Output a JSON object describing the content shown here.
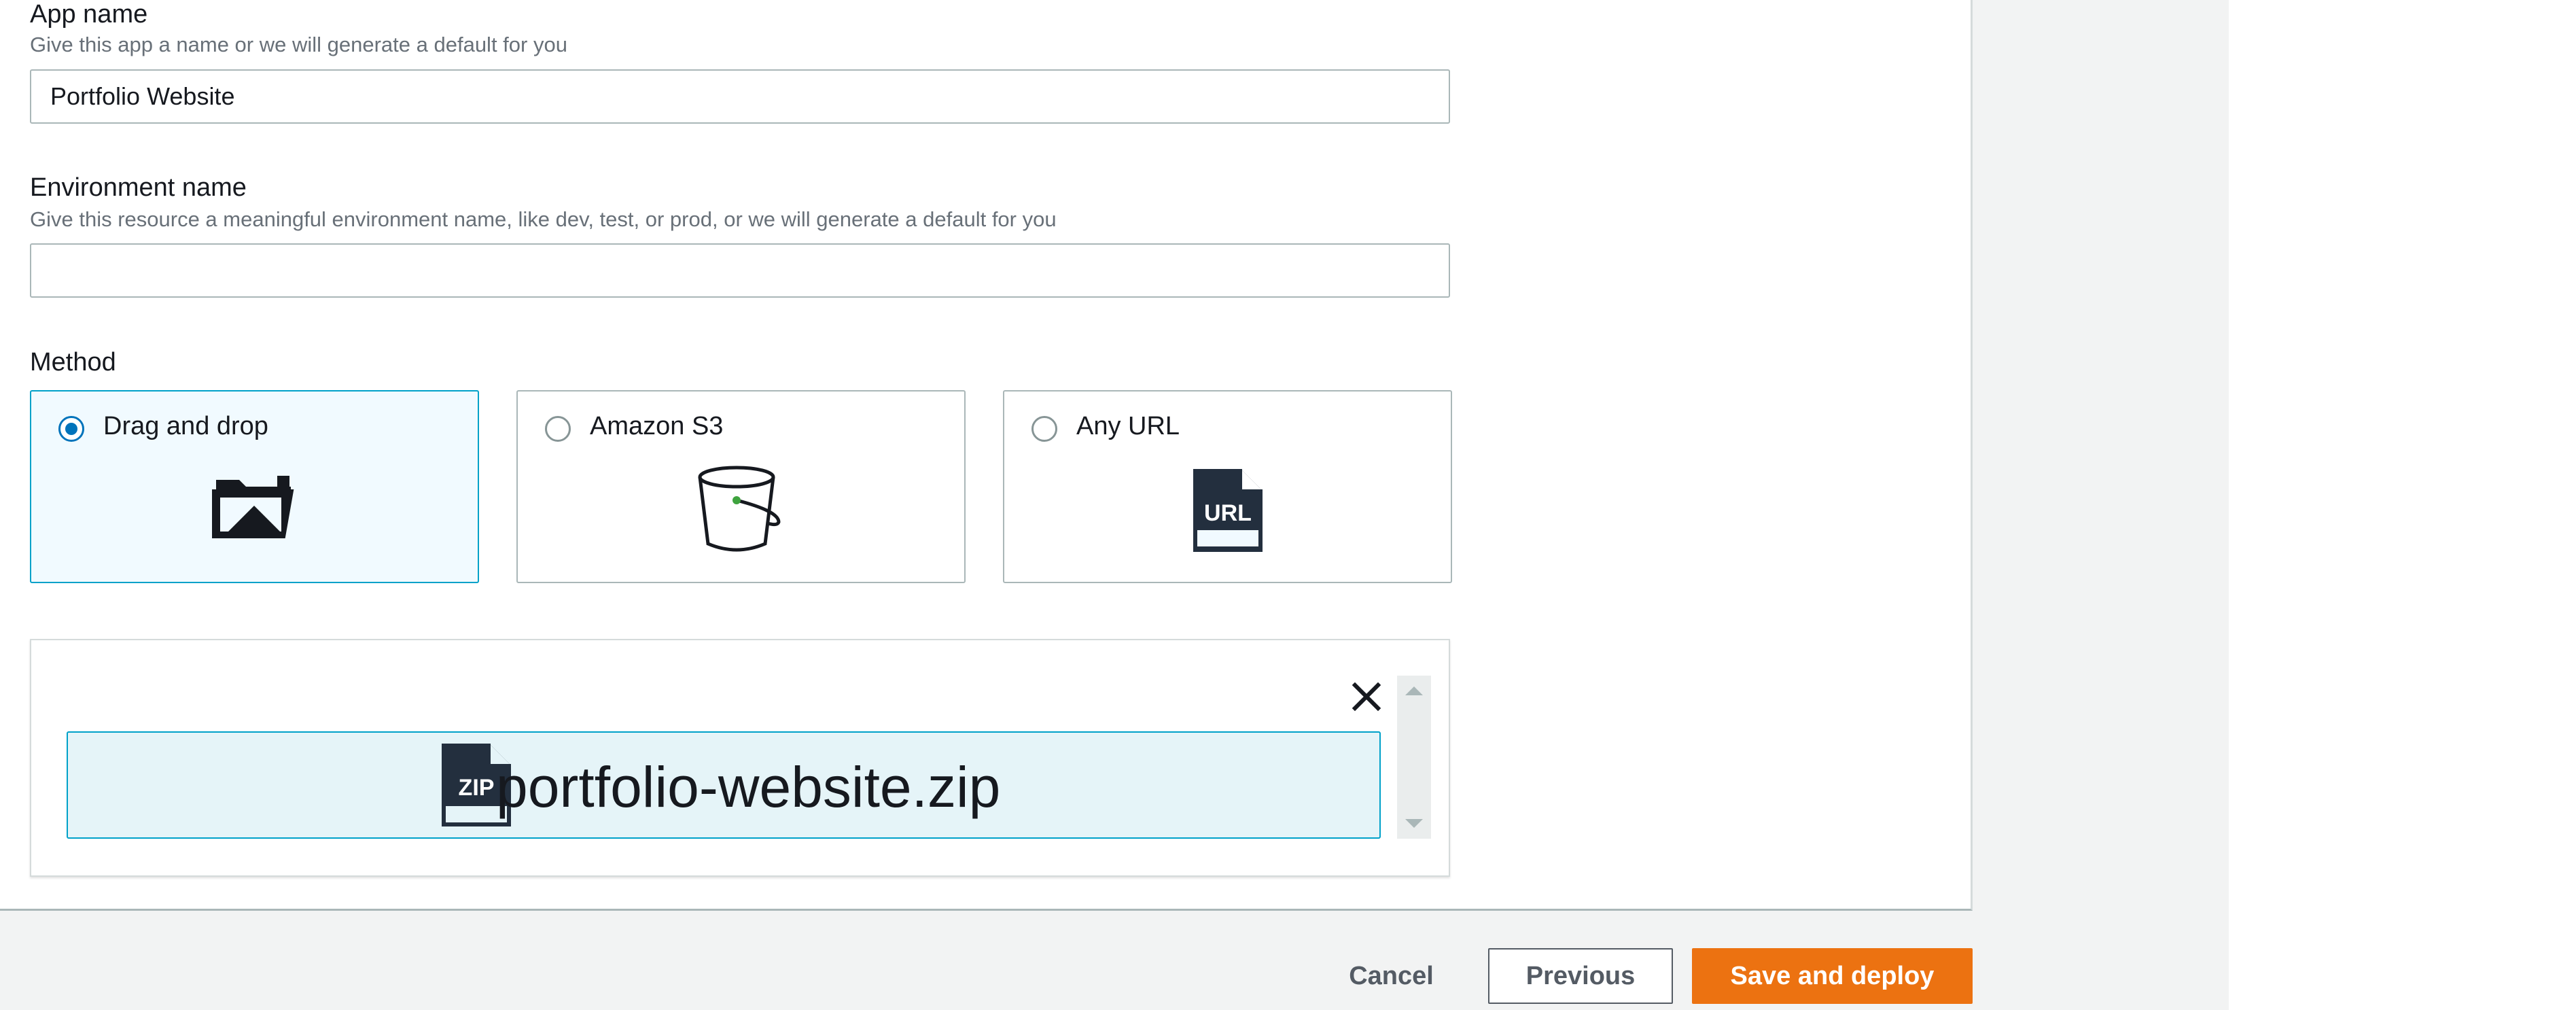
{
  "app_name": {
    "label": "App name",
    "description": "Give this app a name or we will generate a default for you",
    "value": "Portfolio Website"
  },
  "environment_name": {
    "label": "Environment name",
    "description": "Give this resource a meaningful environment name, like dev, test, or prod, or we will generate a default for you",
    "value": ""
  },
  "method": {
    "label": "Method",
    "options": [
      {
        "label": "Drag and drop",
        "icon": "folder-upload-icon",
        "selected": true
      },
      {
        "label": "Amazon S3",
        "icon": "s3-bucket-icon",
        "selected": false
      },
      {
        "label": "Any URL",
        "icon": "url-file-icon",
        "selected": false
      }
    ]
  },
  "upload": {
    "file_name": "portfolio-website.zip",
    "file_icon_text": "ZIP",
    "url_icon_text": "URL"
  },
  "footer": {
    "cancel_label": "Cancel",
    "previous_label": "Previous",
    "save_label": "Save and deploy"
  },
  "colors": {
    "accent": "#0073bb",
    "primary_button": "#ec7211",
    "selected_tile_bg": "#f1faff",
    "file_chip_bg": "#e5f4f8"
  }
}
